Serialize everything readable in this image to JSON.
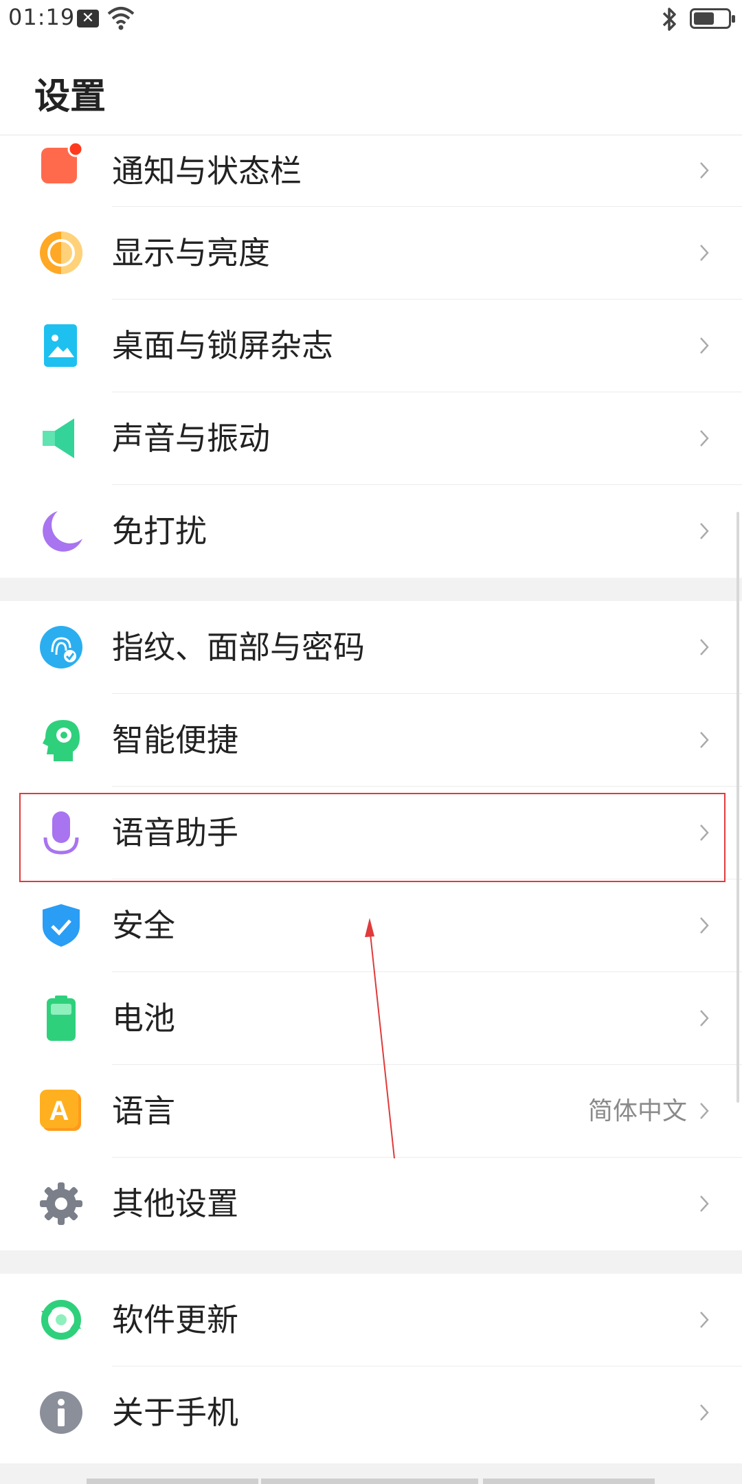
{
  "status_bar": {
    "time": "01:19",
    "notification_icon": "close-box-icon",
    "wifi_icon": "wifi-icon",
    "bluetooth_icon": "bluetooth-icon",
    "battery_level": 0.6
  },
  "header": {
    "title": "设置"
  },
  "groups": [
    {
      "items": [
        {
          "label": "通知与状态栏",
          "icon": "notification-icon",
          "color": "#ff6a4d"
        },
        {
          "label": "显示与亮度",
          "icon": "display-brightness-icon",
          "color": "#ffa826"
        },
        {
          "label": "桌面与锁屏杂志",
          "icon": "wallpaper-icon",
          "color": "#1ec0f0"
        },
        {
          "label": "声音与振动",
          "icon": "speaker-icon",
          "color": "#34d399"
        },
        {
          "label": "免打扰",
          "icon": "moon-icon",
          "color": "#a874f0"
        }
      ]
    },
    {
      "items": [
        {
          "label": "指纹、面部与密码",
          "icon": "fingerprint-icon",
          "color": "#2aaef0"
        },
        {
          "label": "智能便捷",
          "icon": "smart-head-icon",
          "color": "#2fd07c"
        },
        {
          "label": "语音助手",
          "icon": "microphone-icon",
          "color": "#a874f0"
        },
        {
          "label": "安全",
          "icon": "shield-icon",
          "color": "#2a9df4"
        },
        {
          "label": "电池",
          "icon": "battery-icon",
          "color": "#2fd07c"
        },
        {
          "label": "语言",
          "icon": "language-icon",
          "color": "#ffb020",
          "value": "简体中文"
        },
        {
          "label": "其他设置",
          "icon": "gear-icon",
          "color": "#7a7f8a"
        }
      ]
    },
    {
      "items": [
        {
          "label": "软件更新",
          "icon": "update-icon",
          "color": "#2fd07c"
        },
        {
          "label": "关于手机",
          "icon": "info-icon",
          "color": "#8a8f9a"
        }
      ]
    }
  ],
  "annotation": {
    "highlighted_item": "语音助手",
    "color": "#e03a3a"
  }
}
